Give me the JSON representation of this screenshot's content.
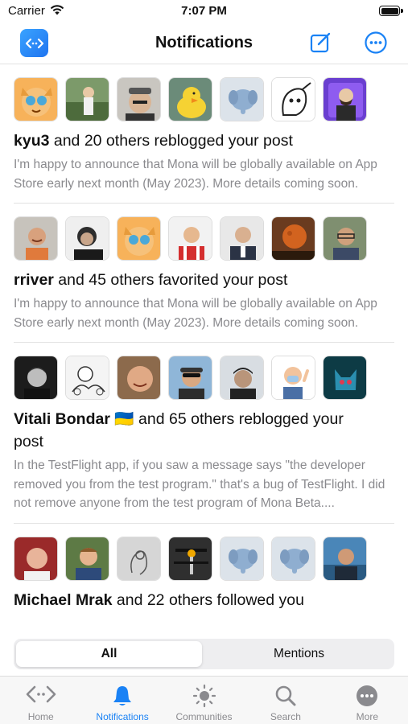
{
  "status_bar": {
    "carrier": "Carrier",
    "time": "7:07 PM"
  },
  "nav": {
    "title": "Notifications"
  },
  "notifications": [
    {
      "name": "kyu3",
      "flag": "",
      "action": " and 20 others reblogged your post",
      "excerpt": "I'm happy to announce that Mona will be globally available on App Store early next month (May 2023). More details coming soon.",
      "avatars": [
        "cat",
        "hiker",
        "man-cap",
        "duck",
        "elephant",
        "ghost",
        "bald-purple"
      ]
    },
    {
      "name": "rriver",
      "flag": "",
      "action": " and 45 others favorited your post",
      "excerpt": "I'm happy to announce that Mona will be globally available on App Store early next month (May 2023). More details coming soon.",
      "avatars": [
        "smiling-man",
        "man-laptop",
        "cat",
        "man-red-shirt",
        "man-suit",
        "moon",
        "man-glasses"
      ]
    },
    {
      "name": "Vitali Bondar",
      "flag": "🇺🇦",
      "action": " and 65 others reblogged your post",
      "excerpt": "In the TestFlight app, if you saw a message says \"the developer removed you from the test program.\" that's a bug of TestFlight. I did not remove anyone from the test program of Mona Beta....",
      "avatars": [
        "man-bw",
        "sketch",
        "smiling-man2",
        "man-sunglasses",
        "man-hat",
        "memoji",
        "blue-cat"
      ]
    },
    {
      "name": "Michael Mrak",
      "flag": "",
      "action": " and 22 others followed you",
      "excerpt": "",
      "avatars": [
        "bald-man",
        "man-blue",
        "drawing",
        "bike",
        "elephant",
        "elephant",
        "man-sea"
      ]
    }
  ],
  "segments": {
    "all": "All",
    "mentions": "Mentions"
  },
  "tabs": [
    {
      "label": "Home",
      "icon": "home-arrows-icon"
    },
    {
      "label": "Notifications",
      "icon": "bell-icon"
    },
    {
      "label": "Communities",
      "icon": "sun-icon"
    },
    {
      "label": "Search",
      "icon": "magnifier-icon"
    },
    {
      "label": "More",
      "icon": "ellipsis-circle-icon"
    }
  ],
  "colors": {
    "accent": "#1a82f5",
    "secondary_text": "#8a8a8e"
  }
}
